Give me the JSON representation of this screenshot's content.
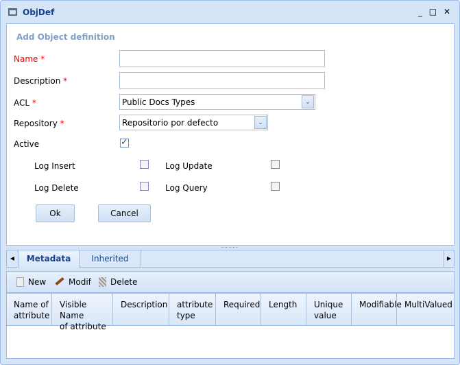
{
  "window": {
    "title": "ObjDef",
    "controls": [
      "_",
      "□",
      "✕"
    ]
  },
  "form": {
    "heading": "Add Object definition",
    "name_label": "Name",
    "description_label": "Description",
    "acl_label": "ACL",
    "repository_label": "Repository",
    "required_mark": "*",
    "name_value": "",
    "description_value": "",
    "acl_value": "Public Docs Types",
    "repository_value": "Repositorio por defecto",
    "active_label": "Active",
    "active_checked": true,
    "log_insert_label": "Log Insert",
    "log_update_label": "Log Update",
    "log_delete_label": "Log Delete",
    "log_query_label": "Log Query",
    "ok_label": "Ok",
    "cancel_label": "Cancel"
  },
  "tabs": [
    {
      "label": "Metadata",
      "active": true
    },
    {
      "label": "Inherited",
      "active": false
    }
  ],
  "toolbar": {
    "new_label": "New",
    "modif_label": "Modif",
    "delete_label": "Delete"
  },
  "grid": {
    "columns": [
      [
        "Name of",
        "attribute"
      ],
      [
        "Visible Name",
        "of attribute"
      ],
      [
        "Description",
        ""
      ],
      [
        "attribute",
        "type"
      ],
      [
        "Required",
        ""
      ],
      [
        "Length",
        ""
      ],
      [
        "Unique",
        "value"
      ],
      [
        "Modifiable",
        ""
      ],
      [
        "MultiValued",
        ""
      ]
    ]
  }
}
